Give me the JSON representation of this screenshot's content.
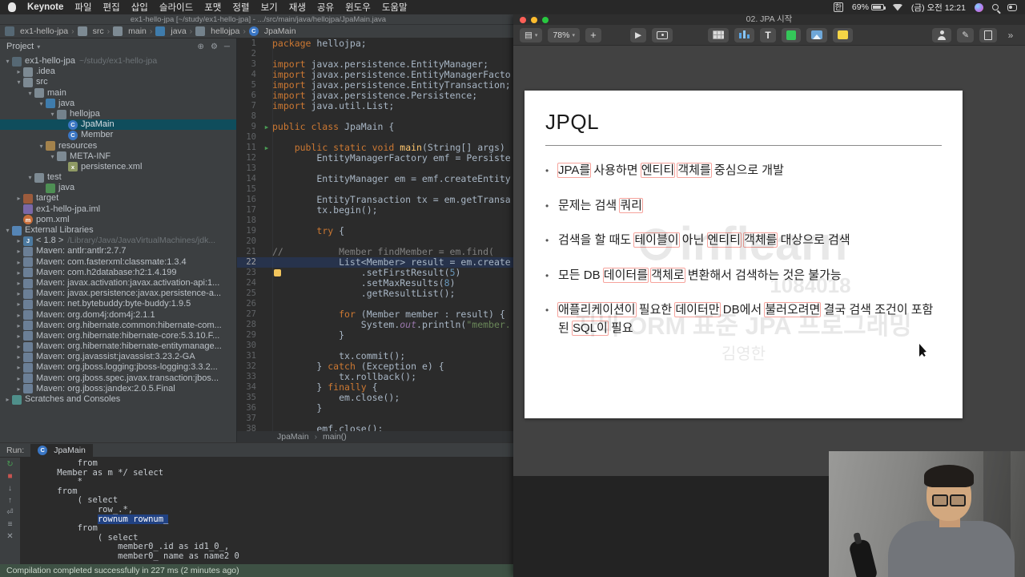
{
  "menubar": {
    "app_name": "Keynote",
    "menus": [
      "파일",
      "편집",
      "삽입",
      "슬라이드",
      "포맷",
      "정렬",
      "보기",
      "재생",
      "공유",
      "윈도우",
      "도움말"
    ],
    "status": {
      "input_source": "한",
      "battery": "69%",
      "datetime": "(금) 오전 12:21",
      "icons": [
        "input-korean",
        "battery",
        "wifi",
        "clock",
        "siri",
        "spotlight",
        "control-center"
      ]
    }
  },
  "idea": {
    "window_title": "ex1-hello-jpa [~/study/ex1-hello-jpa] - .../src/main/java/hellojpa/JpaMain.java",
    "breadcrumbs": [
      {
        "label": "ex1-hello-jpa",
        "icon": "module"
      },
      {
        "label": "src",
        "icon": "folder"
      },
      {
        "label": "main",
        "icon": "folder"
      },
      {
        "label": "java",
        "icon": "src"
      },
      {
        "label": "hellojpa",
        "icon": "package"
      },
      {
        "label": "JpaMain",
        "icon": "class"
      }
    ],
    "project": {
      "title": "Project",
      "header_icons": [
        "locate",
        "settings",
        "hide"
      ],
      "tree": [
        {
          "d": 0,
          "c": "v",
          "i": "module",
          "l": "ex1-hello-jpa",
          "x": "~/study/ex1-hello-jpa"
        },
        {
          "d": 1,
          "c": ">",
          "i": "folder",
          "l": ".idea"
        },
        {
          "d": 1,
          "c": "v",
          "i": "folder",
          "l": "src"
        },
        {
          "d": 2,
          "c": "v",
          "i": "folder",
          "l": "main"
        },
        {
          "d": 3,
          "c": "v",
          "i": "src",
          "l": "java"
        },
        {
          "d": 4,
          "c": "v",
          "i": "package",
          "l": "hellojpa"
        },
        {
          "d": 5,
          "c": "",
          "i": "class",
          "l": "JpaMain",
          "sel": true
        },
        {
          "d": 5,
          "c": "",
          "i": "class",
          "l": "Member"
        },
        {
          "d": 3,
          "c": "v",
          "i": "rsrc",
          "l": "resources"
        },
        {
          "d": 4,
          "c": "v",
          "i": "folder",
          "l": "META-INF"
        },
        {
          "d": 5,
          "c": "",
          "i": "xml",
          "l": "persistence.xml"
        },
        {
          "d": 2,
          "c": "v",
          "i": "folder",
          "l": "test"
        },
        {
          "d": 3,
          "c": "",
          "i": "srcg",
          "l": "java"
        },
        {
          "d": 1,
          "c": ">",
          "i": "excl",
          "l": "target"
        },
        {
          "d": 1,
          "c": "",
          "i": "iml",
          "l": "ex1-hello-jpa.iml"
        },
        {
          "d": 1,
          "c": "",
          "i": "pom",
          "l": "pom.xml"
        },
        {
          "d": 0,
          "c": "v",
          "i": "libs",
          "l": "External Libraries"
        },
        {
          "d": 1,
          "c": ">",
          "i": "jdk",
          "l": "< 1.8 >",
          "x": "/Library/Java/JavaVirtualMachines/jdk..."
        },
        {
          "d": 1,
          "c": ">",
          "i": "lib",
          "l": "Maven: antlr:antlr:2.7.7"
        },
        {
          "d": 1,
          "c": ">",
          "i": "lib",
          "l": "Maven: com.fasterxml:classmate:1.3.4"
        },
        {
          "d": 1,
          "c": ">",
          "i": "lib",
          "l": "Maven: com.h2database:h2:1.4.199"
        },
        {
          "d": 1,
          "c": ">",
          "i": "lib",
          "l": "Maven: javax.activation:javax.activation-api:1..."
        },
        {
          "d": 1,
          "c": ">",
          "i": "lib",
          "l": "Maven: javax.persistence:javax.persistence-a..."
        },
        {
          "d": 1,
          "c": ">",
          "i": "lib",
          "l": "Maven: net.bytebuddy:byte-buddy:1.9.5"
        },
        {
          "d": 1,
          "c": ">",
          "i": "lib",
          "l": "Maven: org.dom4j:dom4j:2.1.1"
        },
        {
          "d": 1,
          "c": ">",
          "i": "lib",
          "l": "Maven: org.hibernate.common:hibernate-com..."
        },
        {
          "d": 1,
          "c": ">",
          "i": "lib",
          "l": "Maven: org.hibernate:hibernate-core:5.3.10.F..."
        },
        {
          "d": 1,
          "c": ">",
          "i": "lib",
          "l": "Maven: org.hibernate:hibernate-entitymanage..."
        },
        {
          "d": 1,
          "c": ">",
          "i": "lib",
          "l": "Maven: org.javassist:javassist:3.23.2-GA"
        },
        {
          "d": 1,
          "c": ">",
          "i": "lib",
          "l": "Maven: org.jboss.logging:jboss-logging:3.3.2..."
        },
        {
          "d": 1,
          "c": ">",
          "i": "lib",
          "l": "Maven: org.jboss.spec.javax.transaction:jbos..."
        },
        {
          "d": 1,
          "c": ">",
          "i": "lib",
          "l": "Maven: org.jboss:jandex:2.0.5.Final"
        },
        {
          "d": 0,
          "c": ">",
          "i": "scratch",
          "l": "Scratches and Consoles"
        }
      ]
    },
    "editor": {
      "breadcrumb": [
        "JpaMain",
        "main()"
      ],
      "lines": [
        {
          "n": 1,
          "s": [
            [
              "kw",
              "package "
            ],
            [
              "pl",
              "hellojpa;"
            ]
          ]
        },
        {
          "n": 2,
          "s": []
        },
        {
          "n": 3,
          "s": [
            [
              "kw",
              "import "
            ],
            [
              "pl",
              "javax.persistence.EntityManager;"
            ]
          ]
        },
        {
          "n": 4,
          "s": [
            [
              "kw",
              "import "
            ],
            [
              "pl",
              "javax.persistence.EntityManagerFacto"
            ]
          ]
        },
        {
          "n": 5,
          "s": [
            [
              "kw",
              "import "
            ],
            [
              "pl",
              "javax.persistence.EntityTransaction;"
            ]
          ]
        },
        {
          "n": 6,
          "s": [
            [
              "kw",
              "import "
            ],
            [
              "pl",
              "javax.persistence.Persistence;"
            ]
          ]
        },
        {
          "n": 7,
          "s": [
            [
              "kw",
              "import "
            ],
            [
              "pl",
              "java.util.List;"
            ]
          ]
        },
        {
          "n": 8,
          "s": []
        },
        {
          "n": 9,
          "run": true,
          "s": [
            [
              "kw",
              "public class "
            ],
            [
              "pl",
              "JpaMain {"
            ]
          ]
        },
        {
          "n": 10,
          "s": []
        },
        {
          "n": 11,
          "run": true,
          "s": [
            [
              "pl",
              "    "
            ],
            [
              "kw",
              "public static void "
            ],
            [
              "fn",
              "main"
            ],
            [
              "pl",
              "(String[] args) "
            ]
          ]
        },
        {
          "n": 12,
          "s": [
            [
              "pl",
              "        EntityManagerFactory emf = Persiste"
            ]
          ]
        },
        {
          "n": 13,
          "s": []
        },
        {
          "n": 14,
          "s": [
            [
              "pl",
              "        EntityManager em = emf.createEntity"
            ]
          ]
        },
        {
          "n": 15,
          "s": []
        },
        {
          "n": 16,
          "s": [
            [
              "pl",
              "        EntityTransaction tx = em.getTransa"
            ]
          ]
        },
        {
          "n": 17,
          "s": [
            [
              "pl",
              "        tx.begin();"
            ]
          ]
        },
        {
          "n": 18,
          "s": []
        },
        {
          "n": 19,
          "s": [
            [
              "pl",
              "        "
            ],
            [
              "kw",
              "try"
            ],
            [
              "pl",
              " {"
            ]
          ]
        },
        {
          "n": 20,
          "s": []
        },
        {
          "n": 21,
          "s": [
            [
              "cm",
              "//          Member findMember = em.find("
            ]
          ]
        },
        {
          "n": 22,
          "cur": true,
          "s": [
            [
              "pl",
              "            List<Member> result = em.create"
            ]
          ]
        },
        {
          "n": 23,
          "bulb": true,
          "s": [
            [
              "pl",
              "                .setFirstResult("
            ],
            [
              "num",
              "5"
            ],
            [
              "pl",
              ")"
            ]
          ]
        },
        {
          "n": 24,
          "s": [
            [
              "pl",
              "                .setMaxResults("
            ],
            [
              "num",
              "8"
            ],
            [
              "pl",
              ")"
            ]
          ]
        },
        {
          "n": 25,
          "s": [
            [
              "pl",
              "                .getResultList();"
            ]
          ]
        },
        {
          "n": 26,
          "s": []
        },
        {
          "n": 27,
          "s": [
            [
              "pl",
              "            "
            ],
            [
              "kw",
              "for"
            ],
            [
              "pl",
              " (Member member : result) {"
            ]
          ]
        },
        {
          "n": 28,
          "s": [
            [
              "pl",
              "                System."
            ],
            [
              "fld",
              "out"
            ],
            [
              "pl",
              ".println("
            ],
            [
              "str",
              "\"member."
            ]
          ]
        },
        {
          "n": 29,
          "s": [
            [
              "pl",
              "            }"
            ]
          ]
        },
        {
          "n": 30,
          "s": []
        },
        {
          "n": 31,
          "s": [
            [
              "pl",
              "            tx.commit();"
            ]
          ]
        },
        {
          "n": 32,
          "s": [
            [
              "pl",
              "        } "
            ],
            [
              "kw",
              "catch"
            ],
            [
              "pl",
              " (Exception e) {"
            ]
          ]
        },
        {
          "n": 33,
          "s": [
            [
              "pl",
              "            tx.rollback();"
            ]
          ]
        },
        {
          "n": 34,
          "s": [
            [
              "pl",
              "        } "
            ],
            [
              "kw",
              "finally"
            ],
            [
              "pl",
              " {"
            ]
          ]
        },
        {
          "n": 35,
          "s": [
            [
              "pl",
              "            em.close();"
            ]
          ]
        },
        {
          "n": 36,
          "s": [
            [
              "pl",
              "        }"
            ]
          ]
        },
        {
          "n": 37,
          "s": []
        },
        {
          "n": 38,
          "s": [
            [
              "pl",
              "        emf.close();"
            ]
          ]
        }
      ]
    },
    "run": {
      "label": "Run:",
      "tab": "JpaMain",
      "rail_icons": [
        "rerun",
        "stop",
        "scroll-down",
        "scroll-up",
        "soft-wrap",
        "settings",
        "clear"
      ],
      "output": [
        {
          "t": "        from"
        },
        {
          "t": "    Member as m */ select"
        },
        {
          "t": "        *"
        },
        {
          "t": "    from"
        },
        {
          "t": "        ( select"
        },
        {
          "t": "            row_.*,"
        },
        {
          "pre": "            ",
          "sel": "rownum rownum_"
        },
        {
          "t": "        from"
        },
        {
          "t": "            ( select"
        },
        {
          "t": "                member0_.id as id1_0_,"
        },
        {
          "t": "                member0_ name as name2 0"
        }
      ]
    },
    "status_bar": {
      "message": "Compilation completed successfully in 227 ms (2 minutes ago)"
    }
  },
  "keynote": {
    "title": "02. JPA 시작",
    "toolbar": {
      "zoom": "78%",
      "add_label": "+",
      "groups": [
        [
          "view",
          "zoom",
          "add-slide"
        ],
        [
          "play",
          "keynote-live"
        ],
        [
          "table",
          "chart",
          "text",
          "shape",
          "media",
          "comment"
        ],
        [
          "collaborate",
          "format",
          "document"
        ]
      ]
    },
    "slide": {
      "title": "JPQL",
      "bullets": [
        [
          {
            "t": "JPA를",
            "box": true
          },
          {
            "t": "사용하면"
          },
          {
            "t": "엔티티",
            "box": true
          },
          {
            "t": "객체를",
            "box": true
          },
          {
            "t": "중심으로"
          },
          {
            "t": "개발"
          }
        ],
        [
          {
            "t": "문제는"
          },
          {
            "t": "검색"
          },
          {
            "t": "쿼리",
            "box": true
          }
        ],
        [
          {
            "t": "검색을"
          },
          {
            "t": "할"
          },
          {
            "t": "때도"
          },
          {
            "t": "테이블이",
            "box": true
          },
          {
            "t": "아닌"
          },
          {
            "t": "엔티티",
            "box": true
          },
          {
            "t": "객체를",
            "box": true
          },
          {
            "t": "대상으로"
          },
          {
            "t": "검색"
          }
        ],
        [
          {
            "t": "모든"
          },
          {
            "t": "DB"
          },
          {
            "t": "데이터를",
            "box": true
          },
          {
            "t": "객체로",
            "box": true
          },
          {
            "t": "변환해서"
          },
          {
            "t": "검색하는"
          },
          {
            "t": "것은"
          },
          {
            "t": "불가능"
          }
        ],
        [
          {
            "t": "애플리케이션이",
            "box": true
          },
          {
            "t": "필요한"
          },
          {
            "t": "데이터만",
            "box": true
          },
          {
            "t": "DB에서"
          },
          {
            "t": "불러오려면",
            "box": true
          },
          {
            "t": "결국"
          },
          {
            "t": "검색"
          },
          {
            "t": "조건이"
          },
          {
            "t": "포함된"
          },
          {
            "t": "SQL이",
            "box": true
          },
          {
            "t": "필요"
          }
        ]
      ]
    },
    "watermark": {
      "brand": "inflearn",
      "code": "1084018",
      "course": "자바 ORM 표준 JPA 프로그래밍",
      "author": "김영한"
    }
  }
}
